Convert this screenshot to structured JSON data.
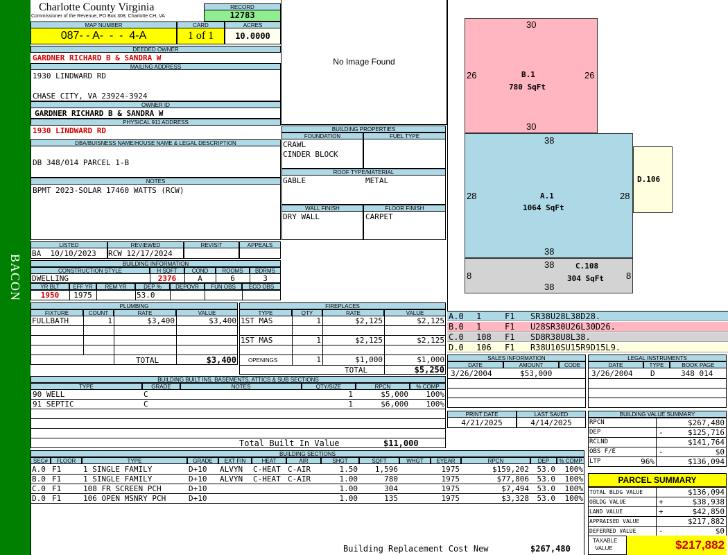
{
  "side_label": "BACON",
  "county": {
    "title": "Charlotte County Virginia",
    "subtitle": "Commissioner of the Revenue, PO Box 308, Charlotte CH, VA"
  },
  "record": {
    "label": "RECORD",
    "value": "12783"
  },
  "map": {
    "label": "MAP NUMBER",
    "value": "087- - A-  -  -  4-A"
  },
  "card": {
    "label": "CARD",
    "value": "1 of 1"
  },
  "acres": {
    "label": "ACRES",
    "value": "10.0000"
  },
  "deeded_owner": {
    "label": "DEEDED OWNER",
    "value": "GARDNER RICHARD B & SANDRA W"
  },
  "mailing": {
    "label": "MAILING ADDRESS",
    "line1": "1930 LINDWARD RD",
    "line2": "CHASE CITY, VA 23924-3924"
  },
  "owner_id": {
    "label": "OWNER ID",
    "value": "GARDNER RICHARD B & SANDRA W"
  },
  "physical": {
    "label": "PHYSICAL 911 ADDRESS",
    "value": "1930 LINDWARD RD"
  },
  "dba": {
    "label": "DBA/BUISNESS NAME/HOUSE NAME & LEGAL DESCRIPTION",
    "value": "DB 348/014 PARCEL 1-B"
  },
  "notes": {
    "label": "NOTES",
    "value": "BPMT 2023-SOLAR 17460 WATTS (RCW)"
  },
  "image": {
    "text": "No Image Found"
  },
  "building_props": {
    "label": "BUILDING PROPERTIES",
    "foundation_label": "FOUNDATION",
    "fuel_label": "FUEL TYPE",
    "foundation": [
      "CRAWL",
      "CINDER BLOCK"
    ],
    "roof_label": "ROOF TYPE/MATERIAL",
    "roof_type": "GABLE",
    "roof_material": "METAL",
    "wall_label": "WALL FINISH",
    "floor_label": "FLOOR FINISH",
    "wall": "DRY WALL",
    "floor": "CARPET"
  },
  "listed": {
    "labels": [
      "LISTED",
      "REVIEWED",
      "REVISIT",
      "APPEALS"
    ],
    "listed": "BA  10/10/2023",
    "reviewed": "RCW 12/17/2024"
  },
  "building_info": {
    "label": "BUILDING INFORMATION",
    "headers1": [
      "CONSTRUCTION STYLE",
      "H SQFT",
      "COND",
      "ROOMS",
      "BDRMS"
    ],
    "style": "DWELLING",
    "hsqft": "2376",
    "cond": "A",
    "rooms": "6",
    "bdrms": "3",
    "headers2": [
      "YR BLT",
      "EFF YR",
      "REM YR",
      "DEP %",
      "DEPOVR",
      "FUN OBS",
      "ECO OBS"
    ],
    "yrblt": "1950",
    "effyr": "1975",
    "dep": "53.0"
  },
  "plumbing": {
    "label": "PLUMBING",
    "headers": [
      "FIXTURE",
      "COUNT",
      "RATE",
      "VALUE"
    ],
    "rows": [
      {
        "fixture": "FULLBATH",
        "count": "1",
        "rate": "$3,400",
        "value": "$3,400"
      }
    ],
    "total_label": "TOTAL",
    "total": "$3,400"
  },
  "fireplaces": {
    "label": "FIREPLACES",
    "headers": [
      "TYPE",
      "QTY",
      "RATE",
      "VALUE"
    ],
    "rows": [
      {
        "type": "1ST MAS",
        "qty": "1",
        "rate": "$2,125",
        "value": "$2,125"
      },
      {
        "type": "1ST MAS",
        "qty": "1",
        "rate": "$2,125",
        "value": "$2,125"
      }
    ],
    "openings": {
      "label": "OPENINGS",
      "qty": "1",
      "rate": "$1,000",
      "value": "$1,000"
    },
    "total_label": "TOTAL",
    "total": "$5,250"
  },
  "builtins": {
    "label": "BUILDING BUILT INS, BASEMENTS, ATTICS & SUB SECTIONS",
    "headers": [
      "TYPE",
      "GRADE",
      "NOTES",
      "QTY/SIZE",
      "RPCN",
      "% COMP"
    ],
    "rows": [
      {
        "type": "90 WELL",
        "grade": "C",
        "qty": "1",
        "rpcn": "$5,000",
        "comp": "100%"
      },
      {
        "type": "91 SEPTIC",
        "grade": "C",
        "qty": "1",
        "rpcn": "$6,000",
        "comp": "100%"
      }
    ],
    "total_label": "Total Built In Value",
    "total": "$11,000"
  },
  "sections": {
    "label": "BUILDING SECTIONS",
    "headers": [
      "SEC#",
      "FLOOR",
      "TYPE",
      "GRADE",
      "EXT FIN",
      "HEAT",
      "AIR",
      "SHGT",
      "SQFT",
      "WHGT",
      "EYEAR",
      "RPCN",
      "DEP",
      "% COMP"
    ],
    "rows": [
      {
        "sec": "A.0",
        "floor": "F1",
        "type": "1 SINGLE FAMILY",
        "grade": "D+10",
        "ext": "ALVYN",
        "heat": "C-HEAT",
        "air": "C-AIR",
        "shgt": "1.50",
        "sqft": "1,596",
        "eyear": "1975",
        "rpcn": "$159,202",
        "dep": "53.0",
        "comp": "100%"
      },
      {
        "sec": "B.0",
        "floor": "F1",
        "type": "1 SINGLE FAMILY",
        "grade": "D+10",
        "ext": "ALVYN",
        "heat": "C-HEAT",
        "air": "C-AIR",
        "shgt": "1.00",
        "sqft": "780",
        "eyear": "1975",
        "rpcn": "$77,806",
        "dep": "53.0",
        "comp": "100%"
      },
      {
        "sec": "C.0",
        "floor": "F1",
        "type": "108 FR SCREEN PCH",
        "grade": "D+10",
        "ext": "",
        "heat": "",
        "air": "",
        "shgt": "1.00",
        "sqft": "304",
        "eyear": "1975",
        "rpcn": "$7,494",
        "dep": "53.0",
        "comp": "100%"
      },
      {
        "sec": "D.0",
        "floor": "F1",
        "type": "106 OPEN MSNRY PCH",
        "grade": "D+10",
        "ext": "",
        "heat": "",
        "air": "",
        "shgt": "1.00",
        "sqft": "135",
        "eyear": "1975",
        "rpcn": "$3,328",
        "dep": "53.0",
        "comp": "100%"
      }
    ],
    "total_label": "Building Replacement Cost New",
    "total": "$267,480"
  },
  "sketch": {
    "b": {
      "name": "B.1",
      "area": "780 SqFt",
      "top": "30",
      "bottom": "30",
      "left": "26",
      "right": "26"
    },
    "a": {
      "name": "A.1",
      "area": "1064 SqFt",
      "top": "38",
      "bottom": "38",
      "left": "28",
      "right": "28"
    },
    "c": {
      "name": "C.108",
      "area": "304 SqFt",
      "top": "38",
      "bottom": "38",
      "left": "8",
      "right": "8"
    },
    "d": {
      "name": "D.106"
    }
  },
  "vectors": [
    {
      "sec": "A.0",
      "n": "1",
      "f": "F1",
      "path": "SR38U28L38D28.",
      "color": "#add8e6"
    },
    {
      "sec": "B.0",
      "n": "1",
      "f": "F1",
      "path": "U28SR30U26L30D26.",
      "color": "#ffb6c1"
    },
    {
      "sec": "C.0",
      "n": "108",
      "f": "F1",
      "path": "SD8R38U8L38.",
      "color": "#d3d3d3"
    },
    {
      "sec": "D.0",
      "n": "106",
      "f": "F1",
      "path": "R38U10SU15R9D15L9.",
      "color": "#ffffe0"
    }
  ],
  "sales": {
    "label": "SALES INFORMATION",
    "headers": [
      "DATE",
      "AMOUNT",
      "CODE"
    ],
    "rows": [
      {
        "date": "3/26/2004",
        "amount": "$53,000",
        "code": ""
      }
    ]
  },
  "legal": {
    "label": "LEGAL INSTRUMENTS",
    "headers": [
      "DATE",
      "TYPE",
      "BOOK PAGE"
    ],
    "rows": [
      {
        "date": "3/26/2004",
        "type": "D",
        "book": "348 014"
      }
    ]
  },
  "dates": {
    "print_label": "PRINT DATE",
    "print": "4/21/2025",
    "saved_label": "LAST SAVED",
    "saved": "4/14/2025"
  },
  "value_summary": {
    "label": "BUILDING VALUE SUMMARY",
    "rows": [
      {
        "k": "RPCN",
        "s": "",
        "v": "$267,480"
      },
      {
        "k": "DEP",
        "s": "-",
        "v": "$125,716"
      },
      {
        "k": "RCLND",
        "s": "",
        "v": "$141,764"
      },
      {
        "k": "OBS F/E",
        "s": "-",
        "v": "$0"
      },
      {
        "k": "LTP",
        "p": "96%",
        "s": "",
        "v": "$136,094"
      }
    ]
  },
  "parcel_summary": {
    "label": "PARCEL SUMMARY",
    "rows": [
      {
        "k": "TOTAL BLDG VALUE",
        "s": "",
        "v": "$136,094"
      },
      {
        "k": "OBLDG VALUE",
        "s": "+",
        "v": "$38,938"
      },
      {
        "k": "LAND VALUE",
        "s": "+",
        "v": "$42,850"
      },
      {
        "k": "APPRAISED VALUE",
        "s": "",
        "v": "$217,882"
      },
      {
        "k": "DEFERRED VALUE",
        "s": "-",
        "v": "$0"
      }
    ],
    "taxable_label1": "TAXABLE",
    "taxable_label2": "VALUE",
    "taxable": "$217,882"
  },
  "colors": {
    "green": "#008000",
    "header": "#add8e6",
    "yellow": "#ffff00",
    "record": "#90ee90"
  }
}
